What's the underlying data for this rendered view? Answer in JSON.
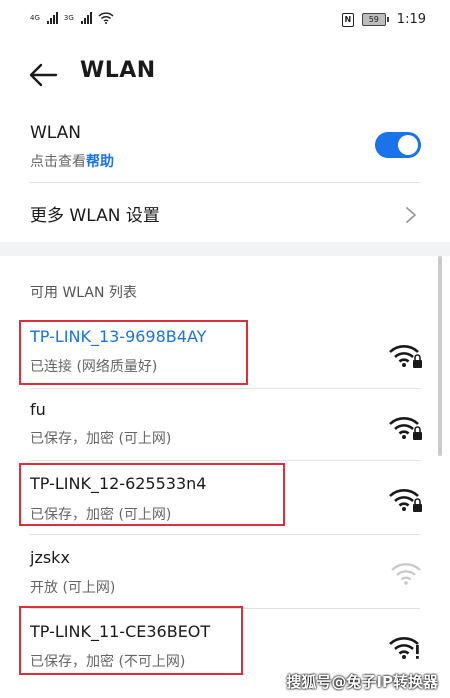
{
  "status_bar": {
    "sim1_label": "4G",
    "sim2_label": "3G",
    "battery": "59",
    "time": "1:19"
  },
  "header": {
    "title": "WLAN"
  },
  "wlan_toggle": {
    "title": "WLAN",
    "subtitle_prefix": "点击查看",
    "help_link": "帮助",
    "enabled": true
  },
  "more_settings": {
    "label": "更多 WLAN 设置"
  },
  "available": {
    "title": "可用 WLAN 列表",
    "networks": [
      {
        "name": "TP-LINK_13-9698B4AY",
        "status": "已连接 (网络质量好)",
        "connected": true,
        "signal": "strong-locked"
      },
      {
        "name": "fu",
        "status": "已保存，加密 (可上网)",
        "connected": false,
        "signal": "strong-locked"
      },
      {
        "name": "TP-LINK_12-625533n4",
        "status": "已保存，加密 (可上网)",
        "connected": false,
        "signal": "strong-locked"
      },
      {
        "name": "jzskx",
        "status": "开放 (可上网)",
        "connected": false,
        "signal": "weak-open"
      },
      {
        "name": "TP-LINK_11-CE36BEOT",
        "status": "已保存，加密 (不可上网)",
        "connected": false,
        "signal": "no-internet"
      }
    ]
  },
  "watermark": "搜狐号@兔子IP转换器",
  "colors": {
    "accent": "#1a73e8",
    "highlight": "#d9303b"
  }
}
